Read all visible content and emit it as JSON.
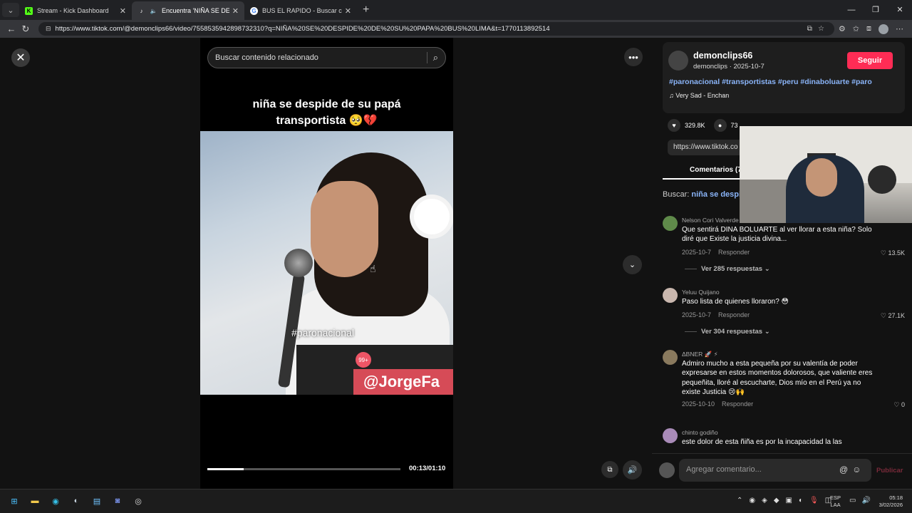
{
  "browser": {
    "tabs": [
      {
        "title": "Stream - Kick Dashboard",
        "icon": "kick-icon",
        "color": "#53fc18",
        "glyph": "K"
      },
      {
        "title": "Encuentra 'NIÑA SE DESPIDE D",
        "icon": "tiktok-icon",
        "color": "#ffffff",
        "glyph": "♪"
      },
      {
        "title": "BUS EL RAPIDO - Buscar con Goog",
        "icon": "google-icon",
        "color": "#4285f4",
        "glyph": "G"
      }
    ],
    "url": "https://www.tiktok.com/@demonclips66/video/7558535942898732310?q=NIÑA%20SE%20DESPIDE%20DE%20SU%20PAPA%20BUS%20LIMA&t=1770113892514"
  },
  "video": {
    "search_placeholder": "Buscar contenido relacionado",
    "caption_line1": "niña se despide de su papá",
    "caption_line2": "transportista 🥺💔",
    "overlay_hashtag": "#paronacional",
    "watermark_handle": "@JorgeFa",
    "watermark_badge": "99+",
    "timecode": "00:13/01:10",
    "progress": 0.19
  },
  "post": {
    "author": "demonclips66",
    "author_sub": "demonclips · 2025-10-7",
    "follow_label": "Seguir",
    "hashtags": "#paronacional #transportistas #peru #dinaboluarte #paro",
    "music": "Very Sad - Enchan",
    "likes": "329.8K",
    "comments_count": "73",
    "link": "https://www.tiktok.co",
    "comments_tab": "Comentarios (7",
    "search_prefix": "Buscar:",
    "search_query": "niña se despide de su papá transportista"
  },
  "comments": [
    {
      "user": "Nelson Cori Valverde",
      "text": "Que sentirá DINA BOLUARTE al ver llorar a esta niña? Solo diré que Existe la justicia divina...",
      "date": "2025-10-7",
      "reply": "Responder",
      "likes": "13.5K",
      "replies": "Ver 285 respuestas"
    },
    {
      "user": "Yeluu Quijano",
      "text": "Paso lista de quienes lloraron? 😳",
      "date": "2025-10-7",
      "reply": "Responder",
      "likes": "27.1K",
      "replies": "Ver 304 respuestas"
    },
    {
      "user": "ΔBNER 🚀 ⚡",
      "text": "Admiro mucho a esta pequeña por su valentía de poder expresarse en estos momentos dolorosos, que valiente eres pequeñita, lloré al escucharte, Dios mío en el Perú ya no existe Justicia 😢🙌",
      "date": "2025-10-10",
      "reply": "Responder",
      "likes": "0"
    },
    {
      "user": "chinto godiño",
      "text": "este dolor de esta ñiña es por la incapacidad la las"
    }
  ],
  "composer": {
    "placeholder": "Agregar comentario...",
    "publish": "Publicar"
  },
  "taskbar": {
    "lang_line1": "ESP",
    "lang_line2": "LAA",
    "time": "05:18",
    "date": "3/02/2026"
  }
}
